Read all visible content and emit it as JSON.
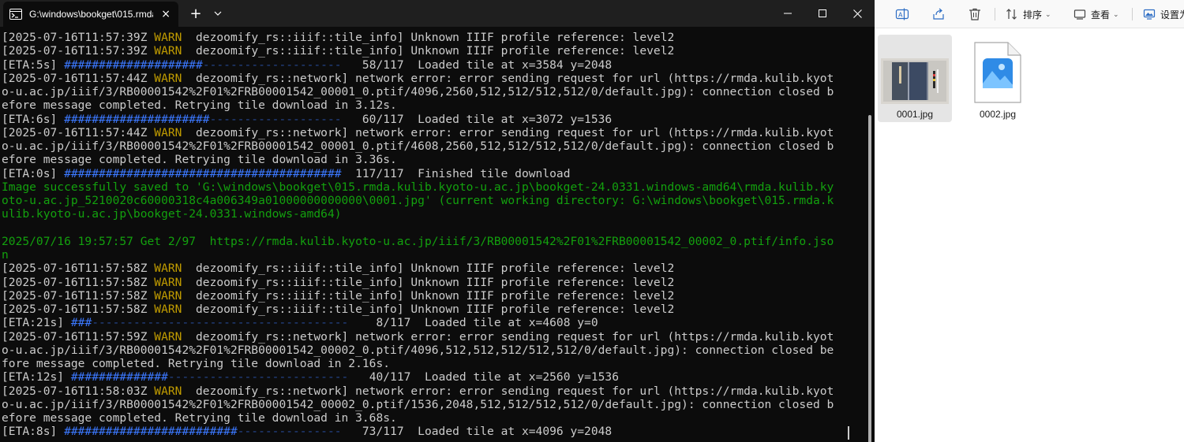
{
  "terminal": {
    "tab_title": "G:\\windows\\bookget\\015.rmda",
    "tab_close_glyph": "×",
    "new_tab_glyph": "+",
    "icons": [
      "terminal-icon",
      "plus-icon",
      "chevron-down-icon",
      "minimize-icon",
      "maximize-icon",
      "close-icon"
    ],
    "lines": [
      [
        {
          "t": "[2025-07-16T11:57:39Z "
        },
        {
          "t": "WARN",
          "c": "warn"
        },
        {
          "t": "  dezoomify_rs::iiif::tile_info] Unknown IIIF profile reference: level2"
        }
      ],
      [
        {
          "t": "[2025-07-16T11:57:39Z "
        },
        {
          "t": "WARN",
          "c": "warn"
        },
        {
          "t": "  dezoomify_rs::iiif::tile_info] Unknown IIIF profile reference: level2"
        }
      ],
      [
        {
          "t": "[ETA:5s] "
        },
        {
          "t": "####################",
          "c": "bar"
        },
        {
          "t": "--------------------",
          "c": "dash"
        },
        {
          "t": "   58/117  Loaded tile at x=3584 y=2048"
        }
      ],
      [
        {
          "t": "[2025-07-16T11:57:44Z "
        },
        {
          "t": "WARN",
          "c": "warn"
        },
        {
          "t": "  dezoomify_rs::network] network error: error sending request for url (https://rmda.kulib.kyot"
        }
      ],
      [
        {
          "t": "o-u.ac.jp/iiif/3/RB00001542%2F01%2FRB00001542_00001_0.ptif/4096,2560,512,512/512,512/0/default.jpg): connection closed b"
        }
      ],
      [
        {
          "t": "efore message completed. Retrying tile download in 3.12s."
        }
      ],
      [
        {
          "t": "[ETA:6s] "
        },
        {
          "t": "#####################",
          "c": "bar"
        },
        {
          "t": "-------------------",
          "c": "dash"
        },
        {
          "t": "   60/117  Loaded tile at x=3072 y=1536"
        }
      ],
      [
        {
          "t": "[2025-07-16T11:57:44Z "
        },
        {
          "t": "WARN",
          "c": "warn"
        },
        {
          "t": "  dezoomify_rs::network] network error: error sending request for url (https://rmda.kulib.kyot"
        }
      ],
      [
        {
          "t": "o-u.ac.jp/iiif/3/RB00001542%2F01%2FRB00001542_00001_0.ptif/4608,2560,512,512/512,512/0/default.jpg): connection closed b"
        }
      ],
      [
        {
          "t": "efore message completed. Retrying tile download in 3.36s."
        }
      ],
      [
        {
          "t": "[ETA:0s] "
        },
        {
          "t": "########################################",
          "c": "bar"
        },
        {
          "t": "  117/117  Finished tile download"
        }
      ],
      [
        {
          "t": "Image successfully saved to 'G:\\windows\\bookget\\015.rmda.kulib.kyoto-u.ac.jp\\bookget-24.0331.windows-amd64\\rmda.kulib.ky",
          "c": "green"
        }
      ],
      [
        {
          "t": "oto-u.ac.jp_5210020c60000318c4a006349a01000000000000\\0001.jpg' (current working directory: G:\\windows\\bookget\\015.rmda.k",
          "c": "green"
        }
      ],
      [
        {
          "t": "ulib.kyoto-u.ac.jp\\bookget-24.0331.windows-amd64)",
          "c": "green"
        }
      ],
      [],
      [
        {
          "t": "2025/07/16 19:57:57 Get 2/97  https://rmda.kulib.kyoto-u.ac.jp/iiif/3/RB00001542%2F01%2FRB00001542_00002_0.ptif/info.jso",
          "c": "green"
        }
      ],
      [
        {
          "t": "n",
          "c": "green"
        }
      ],
      [
        {
          "t": "[2025-07-16T11:57:58Z "
        },
        {
          "t": "WARN",
          "c": "warn"
        },
        {
          "t": "  dezoomify_rs::iiif::tile_info] Unknown IIIF profile reference: level2"
        }
      ],
      [
        {
          "t": "[2025-07-16T11:57:58Z "
        },
        {
          "t": "WARN",
          "c": "warn"
        },
        {
          "t": "  dezoomify_rs::iiif::tile_info] Unknown IIIF profile reference: level2"
        }
      ],
      [
        {
          "t": "[2025-07-16T11:57:58Z "
        },
        {
          "t": "WARN",
          "c": "warn"
        },
        {
          "t": "  dezoomify_rs::iiif::tile_info] Unknown IIIF profile reference: level2"
        }
      ],
      [
        {
          "t": "[2025-07-16T11:57:58Z "
        },
        {
          "t": "WARN",
          "c": "warn"
        },
        {
          "t": "  dezoomify_rs::iiif::tile_info] Unknown IIIF profile reference: level2"
        }
      ],
      [
        {
          "t": "[ETA:21s] "
        },
        {
          "t": "###",
          "c": "bar"
        },
        {
          "t": "-------------------------------------",
          "c": "dash"
        },
        {
          "t": "    8/117  Loaded tile at x=4608 y=0"
        }
      ],
      [
        {
          "t": "[2025-07-16T11:57:59Z "
        },
        {
          "t": "WARN",
          "c": "warn"
        },
        {
          "t": "  dezoomify_rs::network] network error: error sending request for url (https://rmda.kulib.kyot"
        }
      ],
      [
        {
          "t": "o-u.ac.jp/iiif/3/RB00001542%2F01%2FRB00001542_00002_0.ptif/4096,512,512,512/512,512/0/default.jpg): connection closed be"
        }
      ],
      [
        {
          "t": "fore message completed. Retrying tile download in 2.16s."
        }
      ],
      [
        {
          "t": "[ETA:12s] "
        },
        {
          "t": "##############",
          "c": "bar"
        },
        {
          "t": "--------------------------",
          "c": "dash"
        },
        {
          "t": "   40/117  Loaded tile at x=2560 y=1536"
        }
      ],
      [
        {
          "t": "[2025-07-16T11:58:03Z "
        },
        {
          "t": "WARN",
          "c": "warn"
        },
        {
          "t": "  dezoomify_rs::network] network error: error sending request for url (https://rmda.kulib.kyot"
        }
      ],
      [
        {
          "t": "o-u.ac.jp/iiif/3/RB00001542%2F01%2FRB00001542_00002_0.ptif/1536,2048,512,512/512,512/0/default.jpg): connection closed b"
        }
      ],
      [
        {
          "t": "efore message completed. Retrying tile download in 3.68s."
        }
      ],
      [
        {
          "t": "[ETA:8s] "
        },
        {
          "t": "#########################",
          "c": "bar"
        },
        {
          "t": "---------------",
          "c": "dash"
        },
        {
          "t": "   73/117  Loaded tile at x=4096 y=2048"
        }
      ]
    ]
  },
  "explorer": {
    "toolbar": {
      "sort_label": "排序",
      "view_label": "查看",
      "settings_label": "设置为"
    },
    "files": [
      {
        "name": "0001.jpg",
        "kind": "photo-thumbnail",
        "selected": true
      },
      {
        "name": "0002.jpg",
        "kind": "image-file-icon",
        "selected": false
      }
    ]
  },
  "colors": {
    "terminal_bg": "#0c0c0c",
    "titlebar_bg": "#1f1f1f",
    "warn": "#c19c00",
    "progress": "#3b78ff",
    "success": "#13a10e",
    "text": "#cccccc"
  }
}
